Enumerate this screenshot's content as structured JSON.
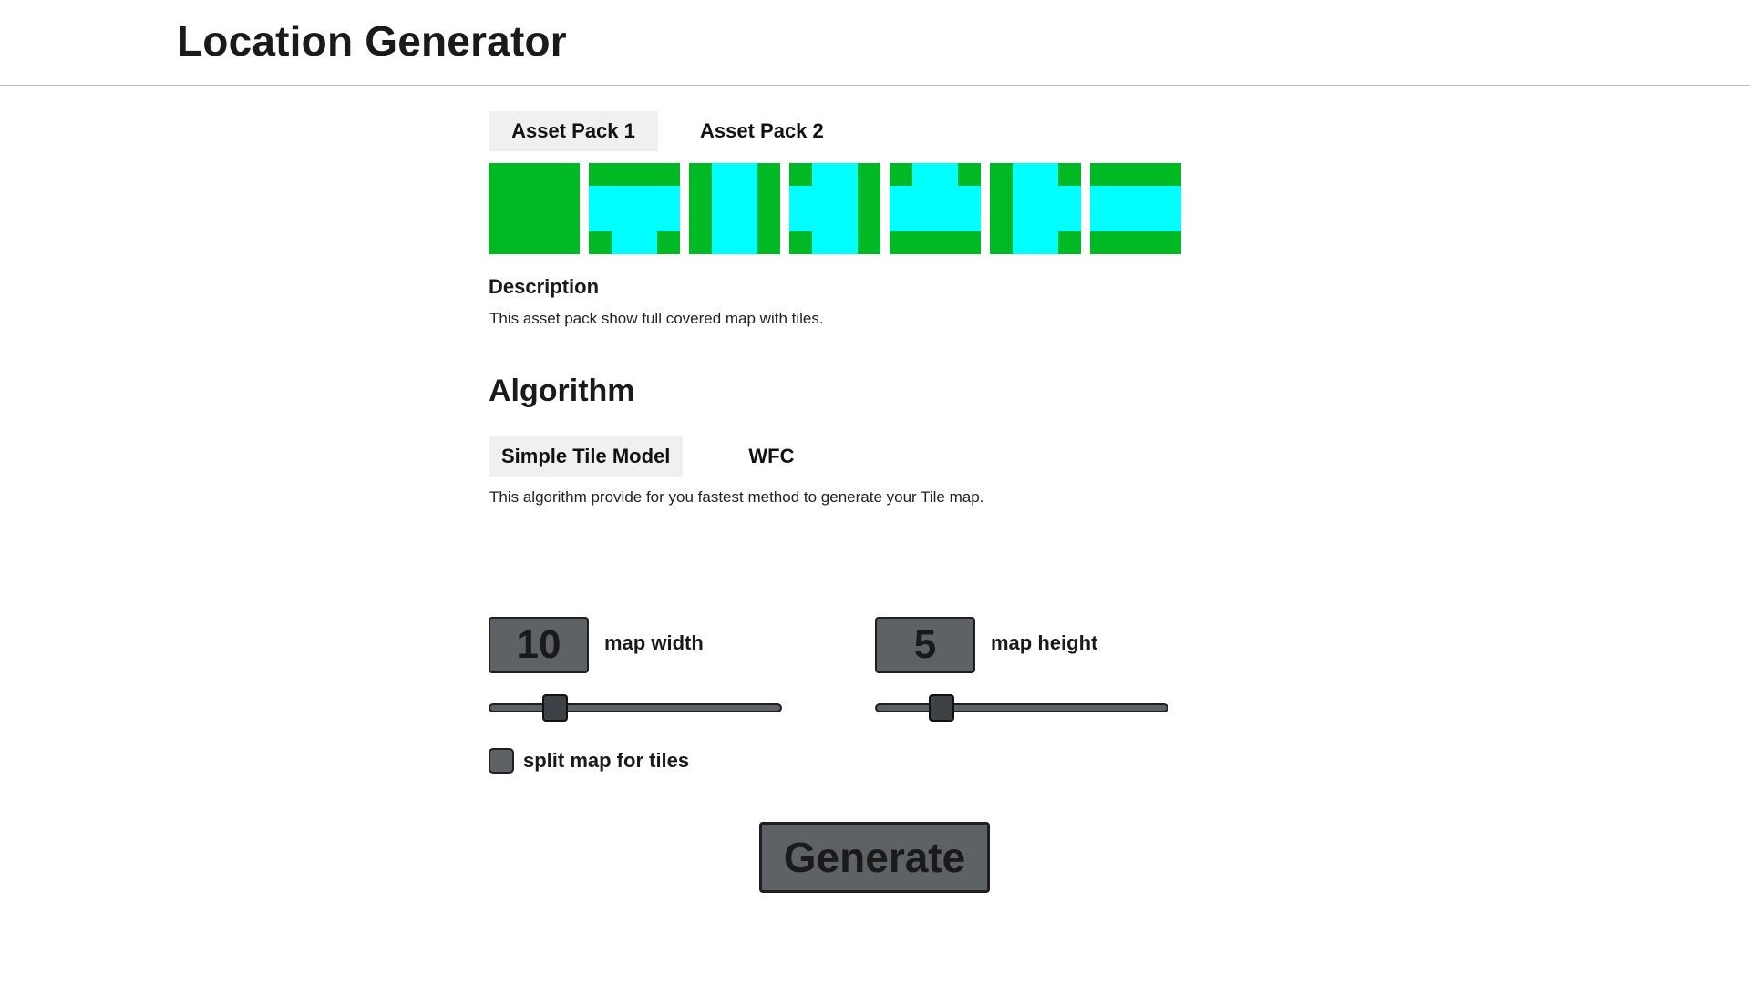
{
  "header": {
    "title": "Location Generator"
  },
  "asset_packs": {
    "tabs": [
      {
        "label": "Asset Pack 1",
        "active": true
      },
      {
        "label": "Asset Pack 2",
        "active": false
      }
    ],
    "tile_colors": {
      "ground": "#00b924",
      "water": "#00ffff"
    },
    "description_title": "Description",
    "description_text": "This asset pack show full covered map with tiles."
  },
  "algorithm": {
    "title": "Algorithm",
    "tabs": [
      {
        "label": "Simple Tile Model",
        "active": true
      },
      {
        "label": "WFC",
        "active": false
      }
    ],
    "description_text": "This algorithm provide for you fastest method to generate your Tile map."
  },
  "settings": {
    "map_width": {
      "value": "10",
      "label": "map width",
      "slider_fraction": 0.2
    },
    "map_height": {
      "value": "5",
      "label": "map height",
      "slider_fraction": 0.2
    },
    "split_checkbox": {
      "label": "split map for tiles",
      "checked": false
    }
  },
  "actions": {
    "generate_label": "Generate"
  }
}
